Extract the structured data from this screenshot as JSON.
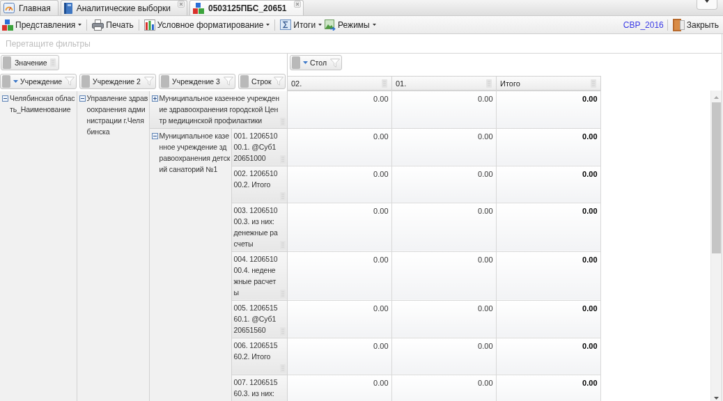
{
  "tabs": [
    {
      "label": "Главная",
      "selected": false,
      "closable": false
    },
    {
      "label": "Аналитические выборки",
      "selected": false,
      "closable": true
    },
    {
      "label": "0503125ПБС_20651",
      "selected": true,
      "closable": true
    }
  ],
  "toolbar": {
    "groups": [
      [
        {
          "label": "Представления",
          "dropdown": true
        }
      ],
      [
        {
          "label": "Печать",
          "dropdown": false
        }
      ],
      [
        {
          "label": "Условное форматирование",
          "dropdown": true
        }
      ],
      [
        {
          "label": "Итоги",
          "dropdown": true
        },
        {
          "label": "Режимы",
          "dropdown": true
        }
      ]
    ],
    "link": "СВР_2016",
    "close_button": "Закрыть"
  },
  "filter_area": {
    "placeholder": "Перетащите фильтры"
  },
  "value_fields": [
    {
      "label": "Значение"
    }
  ],
  "column_fields": [
    {
      "label": "Стол",
      "sorted": true
    }
  ],
  "row_fields": [
    {
      "label": "Учреждение",
      "sorted": true
    },
    {
      "label": "Учреждение 2",
      "sorted": false
    },
    {
      "label": "Учреждение 3",
      "sorted": false
    },
    {
      "label": "Строк",
      "sorted": false
    }
  ],
  "columns": [
    {
      "label": "02.",
      "total": false
    },
    {
      "label": "01.",
      "total": false
    },
    {
      "label": "Итого",
      "total": true
    }
  ],
  "rows": [
    {
      "label": "Челябинская область_Наименование",
      "expanded": true,
      "children": [
        {
          "label": "Управление здравоохранения администрации г.Челябинска",
          "expanded": true,
          "children": [
            {
              "label": "Муниципальное казенное учреждение здравоохранения городской Центр медицинской профилактики",
              "expanded": false,
              "values": [
                "0.00",
                "0.00",
                "0.00"
              ]
            },
            {
              "label": "Муниципальное казенное учреждение здравоохранения детский санаторий №1",
              "expanded": true,
              "children": [
                {
                  "label": "001. 120651000.1. @Суб120651000",
                  "values": [
                    "0.00",
                    "0.00",
                    "0.00"
                  ]
                },
                {
                  "label": "002. 120651000.2. Итого",
                  "values": [
                    "0.00",
                    "0.00",
                    "0.00"
                  ]
                },
                {
                  "label": "003. 120651000.3. из них: денежные расчеты",
                  "values": [
                    "0.00",
                    "0.00",
                    "0.00"
                  ]
                },
                {
                  "label": "004. 120651000.4. неденежные расчеты",
                  "values": [
                    "0.00",
                    "0.00",
                    "0.00"
                  ]
                },
                {
                  "label": "005. 120651560.1. @Суб120651560",
                  "values": [
                    "0.00",
                    "0.00",
                    "0.00"
                  ]
                },
                {
                  "label": "006. 120651560.2. Итого",
                  "values": [
                    "0.00",
                    "0.00",
                    "0.00"
                  ]
                },
                {
                  "label": "007. 120651560.3. из них:",
                  "values": [
                    "0.00",
                    "0.00",
                    "0.00"
                  ]
                }
              ]
            }
          ]
        }
      ]
    }
  ]
}
